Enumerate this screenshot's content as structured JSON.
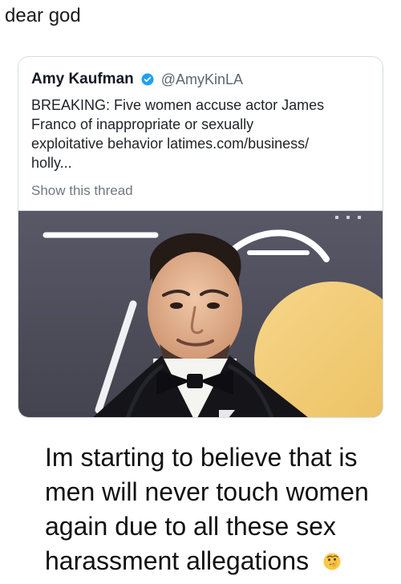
{
  "post": {
    "caption": "dear god"
  },
  "tweet": {
    "author_name": "Amy Kaufman",
    "handle": "@AmyKinLA",
    "text_lines": [
      "BREAKING: Five women accuse actor James",
      "Franco of inappropriate or sexually",
      "exploitative behavior latimes.com/business/",
      "holly..."
    ],
    "show_thread": "Show this thread",
    "verified_icon": "verified-checkmark-icon",
    "colors": {
      "verified_blue": "#1da1f2",
      "handle_gray": "#5b6670",
      "background": "#ffffff"
    },
    "image": {
      "scene": "red carpet portrait photo",
      "colors": {
        "background": "#4c4c58",
        "gold_disc": "#f0c76d",
        "tuxedo": "#151519",
        "shirt": "#f4f4f1"
      }
    }
  },
  "caption_bottom": {
    "text": "Im starting to believe that is men will never touch women again due to all these sex harassment allegations",
    "emoji": "thinking-face-icon"
  }
}
